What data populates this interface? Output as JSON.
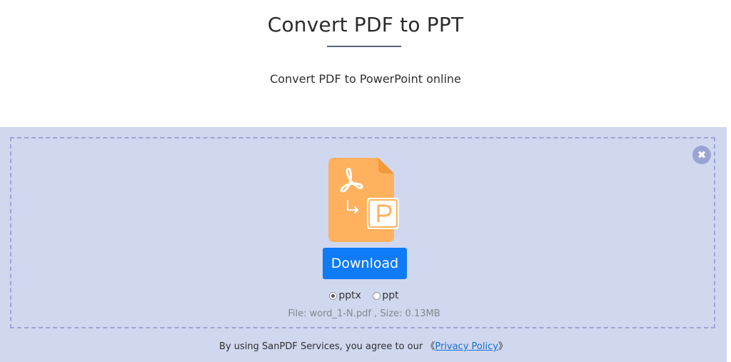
{
  "header": {
    "title": "Convert PDF to PPT",
    "subtitle": "Convert PDF to PowerPoint online"
  },
  "converter": {
    "close_symbol": "✖",
    "file_icon": "pdf-to-ppt-file-icon",
    "download_label": "Download",
    "formats": [
      {
        "label": "pptx",
        "selected": true
      },
      {
        "label": "ppt",
        "selected": false
      }
    ],
    "file_info": "File: word_1-N.pdf , Size: 0.13MB"
  },
  "footer": {
    "text": "By using SanPDF Services, you agree to our ",
    "bracket_open": "《",
    "link_label": "Privacy Policy",
    "bracket_close": "》"
  },
  "colors": {
    "panel_background": "#d0d8ef",
    "dashed_border": "#9aa6d6",
    "download_button": "#0f7bf6",
    "file_icon_fill": "#ffb15e",
    "link": "#1a6fd0"
  }
}
